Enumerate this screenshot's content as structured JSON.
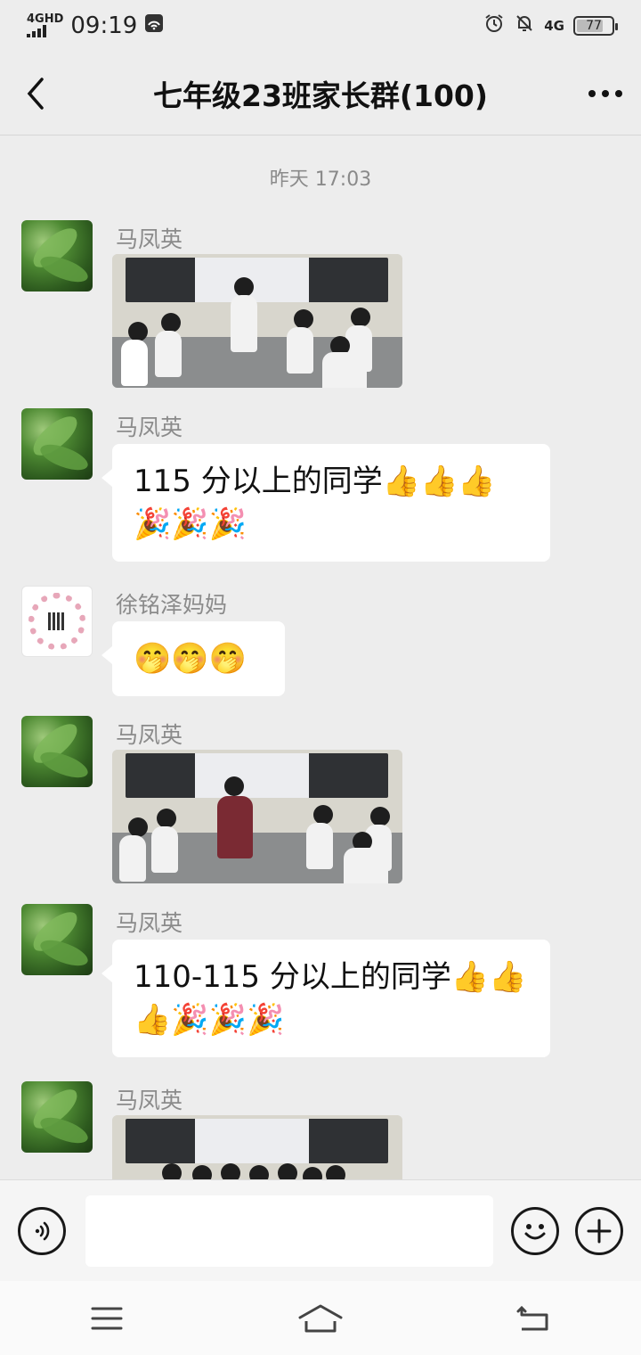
{
  "status_bar": {
    "network_label": "4GHD",
    "time": "09:19",
    "right_network_label": "4G",
    "battery_level": 77,
    "battery_text": "77"
  },
  "header": {
    "title": "七年级23班家长群(100)"
  },
  "chat": {
    "timestamp": "昨天 17:03",
    "messages": [
      {
        "sender": "马凤英",
        "type": "image"
      },
      {
        "sender": "马凤英",
        "type": "text",
        "text": "115 分以上的同学👍👍👍🎉🎉🎉"
      },
      {
        "sender": "徐铭泽妈妈",
        "type": "text",
        "text": "🤭🤭🤭"
      },
      {
        "sender": "马凤英",
        "type": "image"
      },
      {
        "sender": "马凤英",
        "type": "text",
        "text": "110-115 分以上的同学👍👍👍🎉🎉🎉"
      },
      {
        "sender": "马凤英",
        "type": "image"
      }
    ]
  },
  "input_bar": {
    "voice_icon": "voice-icon",
    "emoji_icon": "emoji-icon",
    "plus_icon": "plus-icon",
    "input_value": ""
  },
  "system_nav": {
    "menu_icon": "menu-icon",
    "home_icon": "home-icon",
    "back_icon": "back-icon"
  },
  "colors": {
    "background": "#ededed",
    "bubble": "#ffffff",
    "sender_name": "#8b8b8b",
    "timestamp": "#8a8a8a"
  }
}
